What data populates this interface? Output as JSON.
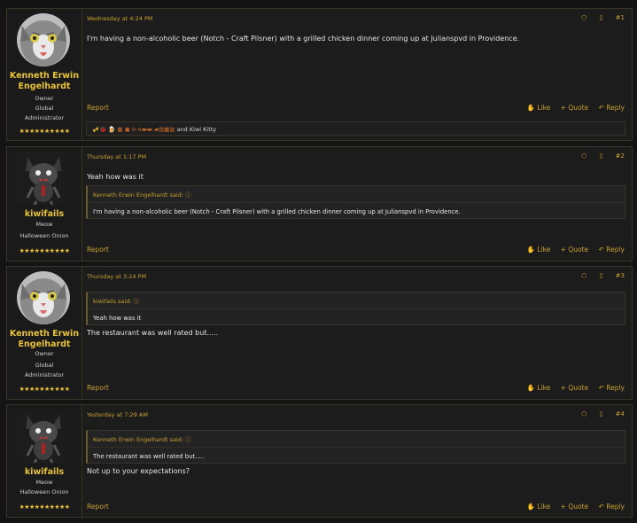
{
  "posts": [
    {
      "date": "Wednesday at 4:24 PM",
      "number": "#1",
      "user": {
        "name": "Kenneth Erwin Engelhardt",
        "roles": [
          "Owner",
          "Global Administrator"
        ],
        "stars": "★★★★★★★★★★",
        "avatar": "gray-cat-avatar"
      },
      "message": "I'm having a non-alcoholic beer (Notch - Craft Pilsner) with a grilled chicken dinner coming up at Julianspvd in Providence.",
      "report": "Report",
      "reactions_text": "and Kiwi Kitty",
      "reactions_prefix": "🎺🐞 🍺 ▦ ▣ ⊳⊲▬▬ ▰▤▦▥",
      "actions": {
        "like": "Like",
        "quote": "+ Quote",
        "reply": "Reply"
      }
    },
    {
      "date": "Thursday at 1:17 PM",
      "number": "#2",
      "user": {
        "name": "kiwifails",
        "roles": [
          "Meow",
          "Halloween Onion"
        ],
        "stars": "★★★★★★★★★★",
        "avatar": "black-cat-avatar"
      },
      "message": "Yeah how was it",
      "quote": {
        "author": "Kenneth Erwin Engelhardt said:",
        "text": "I'm having a non-alcoholic beer (Notch - Craft Pilsner) with a grilled chicken dinner coming up at Julianspvd in Providence."
      },
      "report": "Report",
      "actions": {
        "like": "Like",
        "quote": "+ Quote",
        "reply": "Reply"
      }
    },
    {
      "date": "Thursday at 3:24 PM",
      "number": "#3",
      "user": {
        "name": "Kenneth Erwin Engelhardt",
        "roles": [
          "Owner",
          "Global Administrator"
        ],
        "stars": "★★★★★★★★★★",
        "avatar": "gray-cat-avatar"
      },
      "quote": {
        "author": "kiwifails said:",
        "text": "Yeah how was it"
      },
      "message": "The restaurant was well rated but.....",
      "report": "Report",
      "actions": {
        "like": "Like",
        "quote": "+ Quote",
        "reply": "Reply"
      }
    },
    {
      "date": "Yesterday at 7:29 AM",
      "number": "#4",
      "user": {
        "name": "kiwifails",
        "roles": [
          "Meow",
          "Halloween Onion"
        ],
        "stars": "★★★★★★★★★★",
        "avatar": "black-cat-avatar"
      },
      "quote": {
        "author": "Kenneth Erwin Engelhardt said:",
        "text": "The restaurant was well rated but....."
      },
      "message": "Not up to your expectations?",
      "report": "Report",
      "actions": {
        "like": "Like",
        "quote": "+ Quote",
        "reply": "Reply"
      }
    }
  ],
  "icons": {
    "share": "share-icon",
    "bookmark": "bookmark-icon",
    "like": "thumbs-up-icon",
    "reply": "reply-arrow-icon",
    "quote_expand": "expand-circle-icon"
  },
  "colors": {
    "accent": "#c9a030",
    "username": "#e8c23a",
    "background": "#1c1c1c",
    "border": "#3c3426"
  }
}
